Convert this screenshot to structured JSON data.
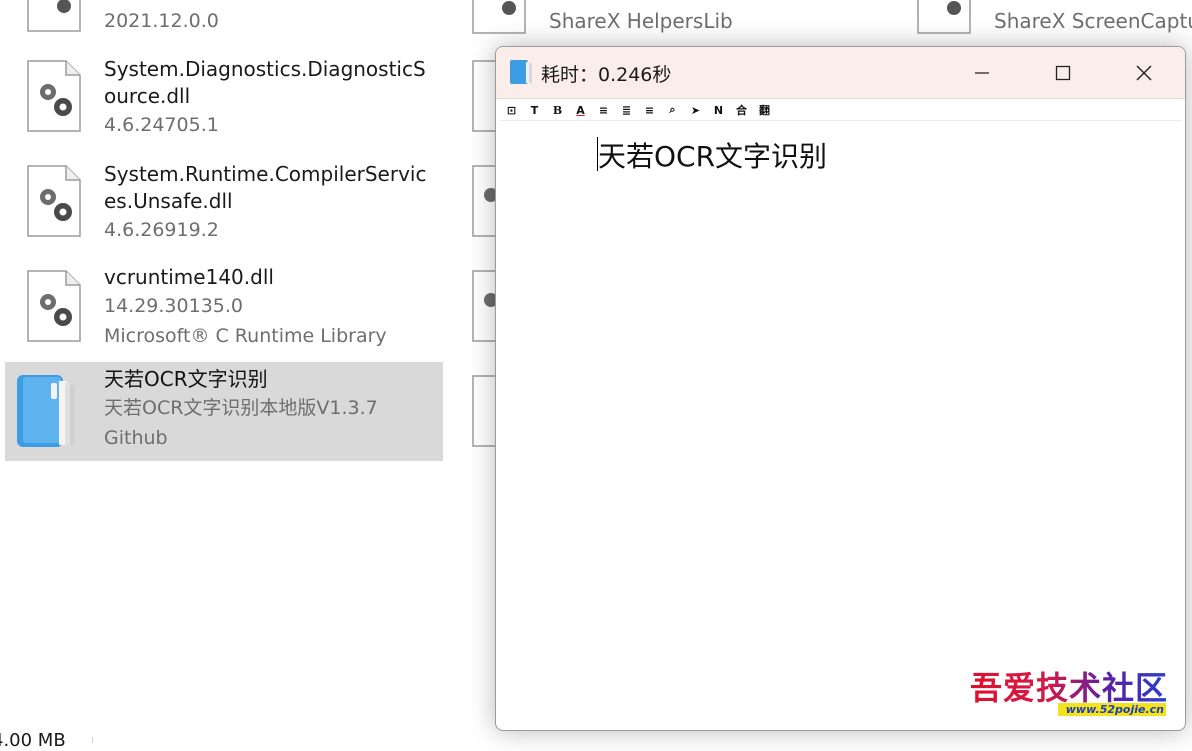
{
  "explorer": {
    "items": [
      {
        "name": "",
        "meta": [
          "2021.12.0.0"
        ]
      },
      {
        "name": "System.Diagnostics.DiagnosticSource.dll",
        "name_lines": [
          "System.Diagnostics.DiagnosticS",
          "ource.dll"
        ],
        "meta": [
          "4.6.24705.1"
        ]
      },
      {
        "name_lines": [
          "System.Runtime.CompilerServic",
          "es.Unsafe.dll"
        ],
        "meta": [
          "4.6.26919.2"
        ]
      },
      {
        "name_lines": [
          "vcruntime140.dll"
        ],
        "meta": [
          "14.29.30135.0",
          "Microsoft® C Runtime Library"
        ]
      },
      {
        "name_lines": [
          "天若OCR文字识别"
        ],
        "meta": [
          "天若OCR文字识别本地版V1.3.7",
          "Github"
        ]
      }
    ],
    "col2_top": "ShareX HelpersLib",
    "col3_top": "ShareX ScreenCaptu",
    "status_size": "4.00 MB"
  },
  "ocr_window": {
    "title": "耗时：0.246秒",
    "toolbar": [
      {
        "glyph": "⊡",
        "icon": "box-icon"
      },
      {
        "glyph": "T",
        "icon": "text-icon"
      },
      {
        "glyph": "B",
        "icon": "bold-icon"
      },
      {
        "glyph": "A",
        "icon": "font-color-icon"
      },
      {
        "glyph": "≡",
        "icon": "align-left-icon"
      },
      {
        "glyph": "≣",
        "icon": "align-center-icon"
      },
      {
        "glyph": "≡",
        "icon": "align-right-icon"
      },
      {
        "glyph": "⌕",
        "icon": "search-icon"
      },
      {
        "glyph": "➤",
        "icon": "send-icon"
      },
      {
        "glyph": "N",
        "icon": "n-icon"
      },
      {
        "glyph": "合",
        "icon": "merge-icon"
      },
      {
        "glyph": "翻",
        "icon": "translate-icon"
      }
    ],
    "result_text": "天若OCR文字识别"
  },
  "watermark": {
    "text": "吾爱技术社区",
    "url": "www.52pojie.cn"
  },
  "colors": {
    "selection": "#d9d9d9",
    "titlebar": "#fbeeea",
    "icon_blue": "#3d9de4"
  }
}
